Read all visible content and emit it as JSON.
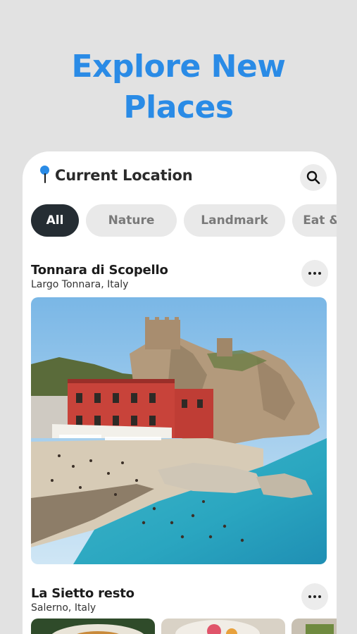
{
  "headline": {
    "line1": "Explore New",
    "line2": "Places"
  },
  "location": {
    "title": "Current Location",
    "pin_icon": "map-pin-icon",
    "search_icon": "search-icon"
  },
  "categories": [
    "All",
    "Nature",
    "Landmark",
    "Eat & Drink"
  ],
  "selected_category": "All",
  "places": [
    {
      "name": "Tonnara di Scopello",
      "location": "Largo Tonnara, Italy",
      "menu_icon": "more-horizontal-icon"
    },
    {
      "name": "La Sietto resto",
      "location": "Salerno, Italy",
      "menu_icon": "more-horizontal-icon"
    }
  ],
  "colors": {
    "accent": "#2a8be6",
    "active_chip": "#252d33",
    "chip": "#e9e9e9",
    "background": "#e2e2e2"
  }
}
